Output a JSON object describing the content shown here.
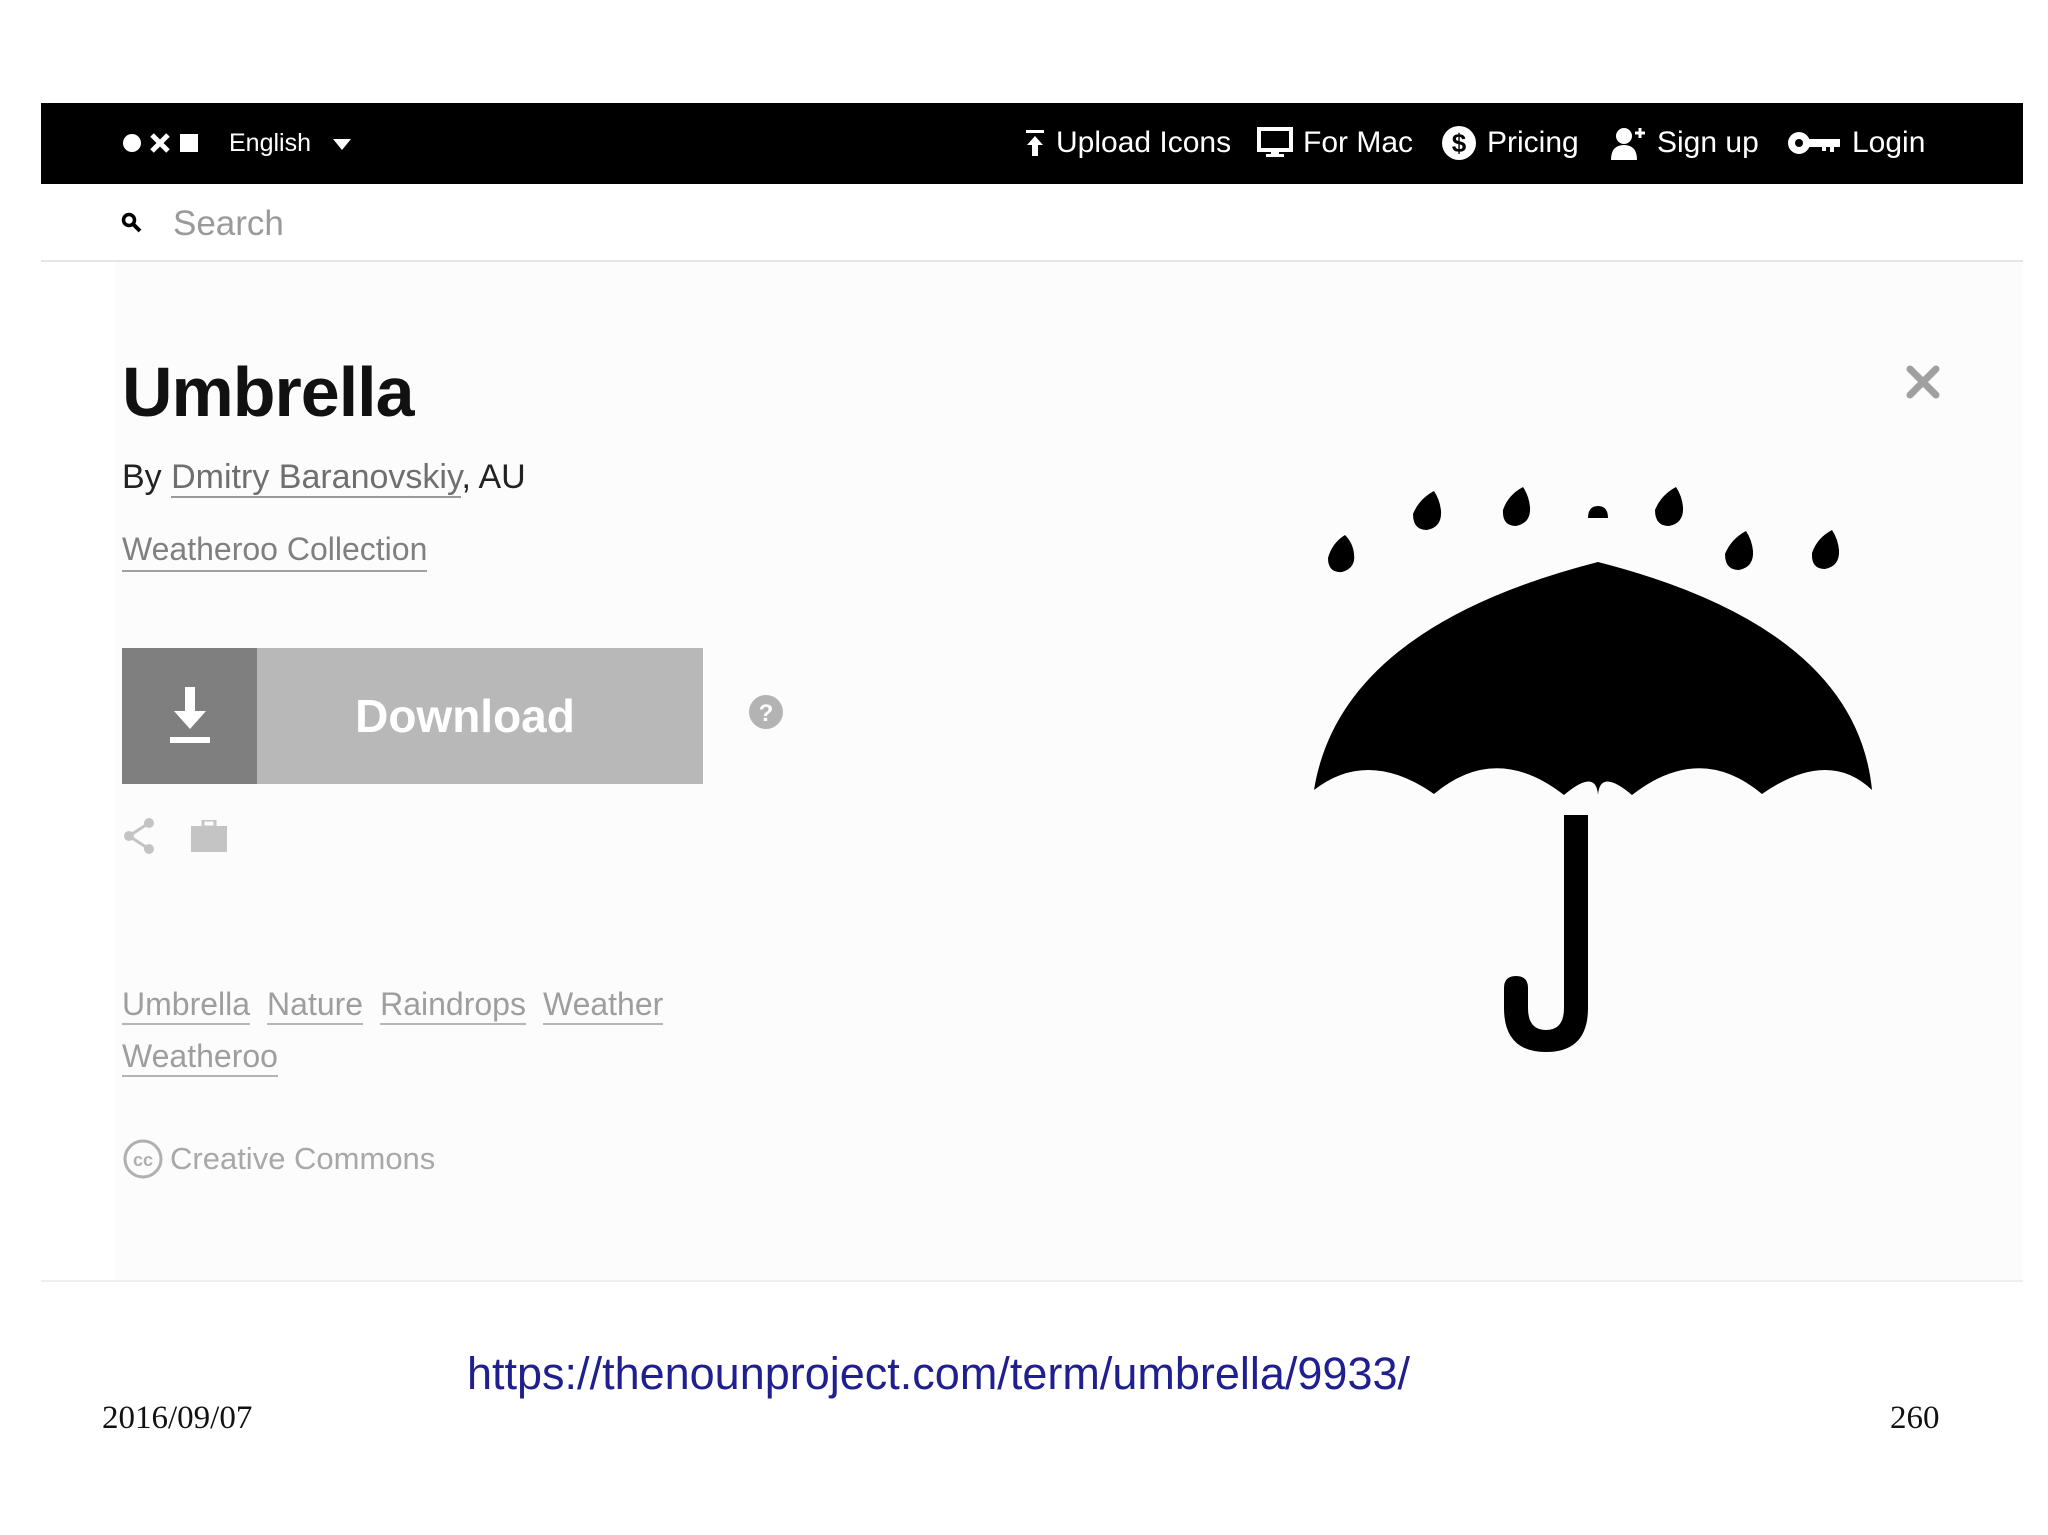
{
  "header": {
    "language": "English",
    "nav": {
      "upload": "Upload Icons",
      "mac": "For Mac",
      "pricing": "Pricing",
      "signup": "Sign up",
      "login": "Login"
    }
  },
  "search": {
    "placeholder": "Search"
  },
  "icon_detail": {
    "title": "Umbrella",
    "by_prefix": "By ",
    "author": "Dmitry Baranovskiy",
    "location": ", AU",
    "collection": "Weatheroo Collection",
    "download_label": "Download",
    "tags": [
      "Umbrella",
      "Nature",
      "Raindrops",
      "Weather",
      "Weatheroo"
    ],
    "license": "Creative Commons"
  },
  "slide": {
    "url": "https://thenounproject.com/term/umbrella/9933/",
    "date": "2016/09/07",
    "page_number": "260"
  },
  "colors": {
    "topbar": "#000000",
    "download_icon_bg": "#7f7f7f",
    "download_label_bg": "#b8b8b8",
    "url_text": "#1f1f8f"
  },
  "icons": [
    "logo-icon",
    "caret-down-icon",
    "upload-icon",
    "monitor-icon",
    "dollar-icon",
    "add-user-icon",
    "key-icon",
    "search-icon",
    "close-icon",
    "download-arrow-icon",
    "help-icon",
    "share-icon",
    "briefcase-icon",
    "creative-commons-icon",
    "umbrella-icon"
  ]
}
